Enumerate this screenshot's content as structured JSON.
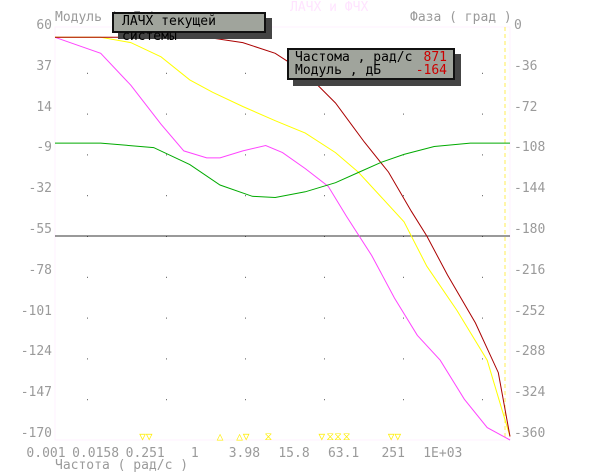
{
  "chart_data": {
    "type": "line",
    "title": "ЛАЧХ и ФЧХ",
    "xlabel": "Частота ( рад/с )",
    "ylabel_left": "Модуль ( дБ )",
    "ylabel_right": "Фаза ( град )",
    "xscale": "log",
    "xlim": [
      0.001,
      1000
    ],
    "ylim_left": [
      -170,
      60
    ],
    "ylim_right": [
      -360,
      0
    ],
    "x_ticks": [
      "0.001",
      "0.0158",
      "0.251",
      "1",
      "3.98",
      "15.8",
      "63.1",
      "251",
      "1E+03"
    ],
    "y_ticks_left": [
      "60",
      "37",
      "14",
      "-9",
      "-32",
      "-55",
      "-78",
      "-101",
      "-124",
      "-147",
      "-170"
    ],
    "y_ticks_right": [
      "0",
      "-36",
      "-72",
      "-108",
      "-144",
      "-180",
      "-216",
      "-252",
      "-288",
      "-324",
      "-360"
    ],
    "reference_line_db": -55,
    "series": [
      {
        "name": "magenta",
        "color": "#ff44ff",
        "points": [
          [
            0.001,
            57
          ],
          [
            0.004,
            48
          ],
          [
            0.01,
            30
          ],
          [
            0.025,
            8
          ],
          [
            0.05,
            -7
          ],
          [
            0.1,
            -11
          ],
          [
            0.15,
            -11
          ],
          [
            0.3,
            -7
          ],
          [
            0.6,
            -4
          ],
          [
            1,
            -8
          ],
          [
            2,
            -17
          ],
          [
            4,
            -27
          ],
          [
            7,
            -44
          ],
          [
            15,
            -66
          ],
          [
            30,
            -90
          ],
          [
            60,
            -111
          ],
          [
            120,
            -125
          ],
          [
            250,
            -147
          ],
          [
            500,
            -163
          ],
          [
            1000,
            -170
          ]
        ]
      },
      {
        "name": "yellow",
        "color": "#ffff00",
        "points": [
          [
            0.001,
            57
          ],
          [
            0.004,
            57
          ],
          [
            0.01,
            54
          ],
          [
            0.025,
            46
          ],
          [
            0.06,
            33
          ],
          [
            0.12,
            26
          ],
          [
            0.3,
            18
          ],
          [
            0.8,
            10
          ],
          [
            2,
            3
          ],
          [
            5,
            -8
          ],
          [
            10,
            -19
          ],
          [
            20,
            -33
          ],
          [
            40,
            -47
          ],
          [
            80,
            -72
          ],
          [
            200,
            -97
          ],
          [
            500,
            -125
          ],
          [
            1000,
            -168
          ]
        ]
      },
      {
        "name": "darkred",
        "color": "#aa0000",
        "points": [
          [
            0.001,
            57
          ],
          [
            0.1,
            57
          ],
          [
            0.3,
            54
          ],
          [
            0.8,
            48
          ],
          [
            2,
            37
          ],
          [
            5,
            20
          ],
          [
            12,
            -2
          ],
          [
            25,
            -19
          ],
          [
            50,
            -41
          ],
          [
            80,
            -55
          ],
          [
            150,
            -77
          ],
          [
            350,
            -104
          ],
          [
            700,
            -132
          ],
          [
            1000,
            -168
          ]
        ]
      },
      {
        "name": "green_phase",
        "color": "#00aa00",
        "points": [
          [
            0.001,
            -98
          ],
          [
            0.004,
            -98
          ],
          [
            0.02,
            -102
          ],
          [
            0.06,
            -117
          ],
          [
            0.15,
            -135
          ],
          [
            0.4,
            -145
          ],
          [
            0.8,
            -146
          ],
          [
            2,
            -141
          ],
          [
            5,
            -133
          ],
          [
            10,
            -124
          ],
          [
            20,
            -115
          ],
          [
            40,
            -108
          ],
          [
            100,
            -101
          ],
          [
            300,
            -98
          ],
          [
            1000,
            -98
          ]
        ]
      }
    ],
    "markers": [
      {
        "glyph": "▽▽",
        "x": 0.0158
      },
      {
        "glyph": "△",
        "x": 0.15
      },
      {
        "glyph": "△▽",
        "x": 0.3
      },
      {
        "glyph": "⧖",
        "x": 0.65
      },
      {
        "glyph": "▽",
        "x": 3.3
      },
      {
        "glyph": "⧖⧖",
        "x": 4.8
      },
      {
        "glyph": "⧖",
        "x": 7
      },
      {
        "glyph": "▽▽",
        "x": 30
      }
    ]
  },
  "popup1": {
    "label": "ЛАЧХ текущей системы"
  },
  "popup2": {
    "freq_label": "Частома , рад/с",
    "freq_value": "871",
    "mod_label": "Модуль , дБ",
    "mod_value": "-164"
  }
}
